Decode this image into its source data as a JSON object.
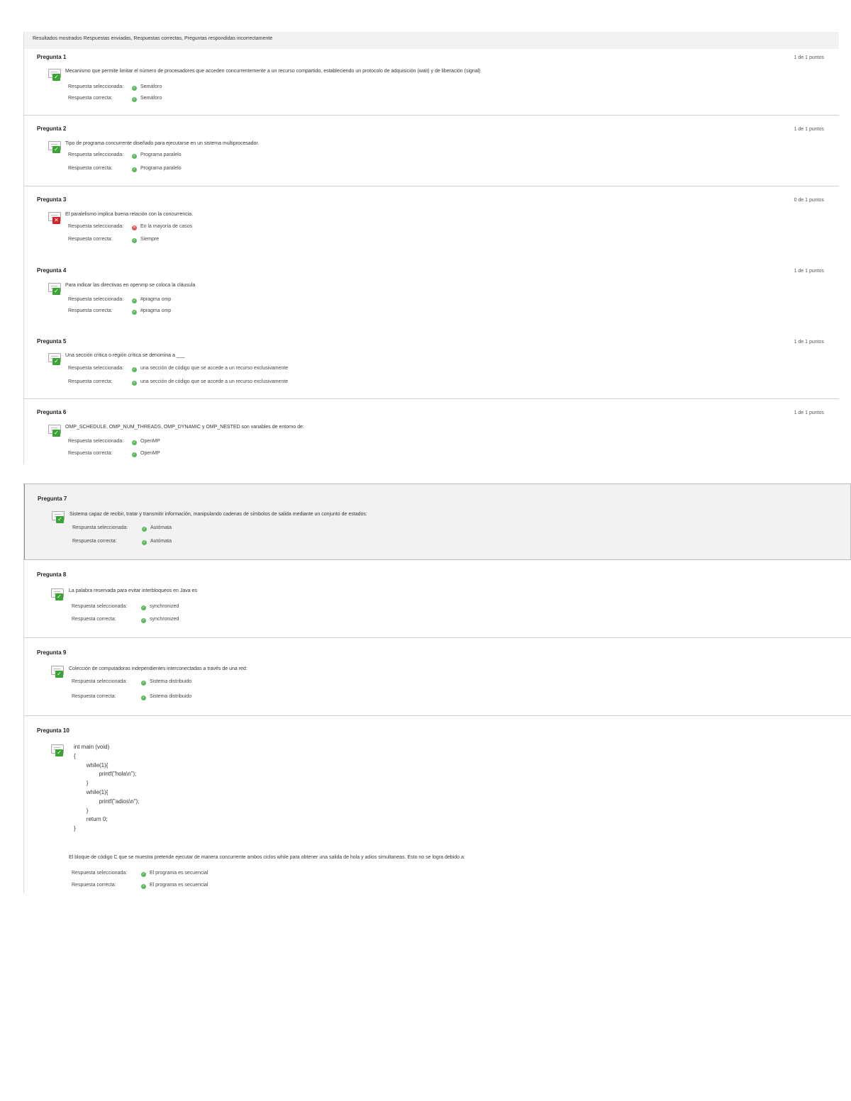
{
  "results_bar": "Resultados mostrados Respuestas enviadas, Respuestas correctas, Preguntas respondidas incorrectamente",
  "labels": {
    "selected": "Respuesta seleccionada:",
    "correct": "Respuesta correcta:"
  },
  "questions": [
    {
      "title": "Pregunta 1",
      "points": "1 de 1 puntos",
      "text": "Mecanismo que permite limitar el número de procesadores que acceden concurrentemente a un recurso compartido, estableciendo un protocolo de adquisición (wait) y de liberación (signal)",
      "selected": "Semáforo",
      "correct": "Semáforo",
      "status": "correct"
    },
    {
      "title": "Pregunta 2",
      "points": "1 de 1 puntos",
      "text": "Tipo de programa concurrente diseñado para ejecutarse en un sistema multiprocesador.",
      "selected": "Programa paralelo",
      "correct": "Programa paralelo",
      "status": "correct"
    },
    {
      "title": "Pregunta 3",
      "points": "0 de 1 puntos",
      "text": "El paralelismo implica buena relación con la concurrencia.",
      "selected": "En la mayoría de casos",
      "correct": "Siempre",
      "status": "incorrect"
    },
    {
      "title": "Pregunta 4",
      "points": "1 de 1 puntos",
      "text": "Para indicar las directivas en openmp se coloca la cláusula",
      "selected": "#pragma omp",
      "correct": "#pragma omp",
      "status": "correct"
    },
    {
      "title": "Pregunta 5",
      "points": "1 de 1 puntos",
      "text": "Una sección crítica o región crítica se denomina a ___",
      "selected": "una sección de código que se accede a un recurso exclusivamente",
      "correct": "una sección de código que se accede a un recurso exclusivamente",
      "status": "correct"
    },
    {
      "title": "Pregunta 6",
      "points": "1 de 1 puntos",
      "text": "OMP_SCHEDULE, OMP_NUM_THREADS, OMP_DYNAMIC y OMP_NESTED son variables de entorno de:",
      "selected": "OpenMP",
      "correct": "OpenMP",
      "status": "correct"
    },
    {
      "title": "Pregunta 7",
      "points": "",
      "text": "Sistema capaz de recibir, tratar y transmitir información, manipulando cadenas de símbolos de salida mediante un conjunto de estados:",
      "selected": "Autómata",
      "correct": "Autómata",
      "status": "correct"
    },
    {
      "title": "Pregunta 8",
      "points": "",
      "text": "La palabra reservada para evitar interbloqueos en Java es",
      "selected": "synchronized",
      "correct": "synchronized",
      "status": "correct"
    },
    {
      "title": "Pregunta 9",
      "points": "",
      "text": "Colección de computadoras independientes interconectadas a través de una red:",
      "selected": "Sistema distribuido",
      "correct": "Sistema distribuido",
      "status": "correct"
    },
    {
      "title": "Pregunta 10",
      "points": "",
      "text": "El bloque de código C que se muestra pretende ejecutar de manera concurrente ambos ciclos while para obtener una salida de hola y adios simultaneas. Esto no se logra debido a:",
      "selected": "El programa es secuencial",
      "correct": "El programa es secuencial",
      "status": "correct",
      "code": [
        "int main (void)",
        "{",
        "        while(1){",
        "                printf(\"hola\\n\");",
        "        }",
        "        while(1){",
        "                printf(\"adios\\n\");",
        "        }",
        "        return 0;",
        "}"
      ]
    }
  ]
}
